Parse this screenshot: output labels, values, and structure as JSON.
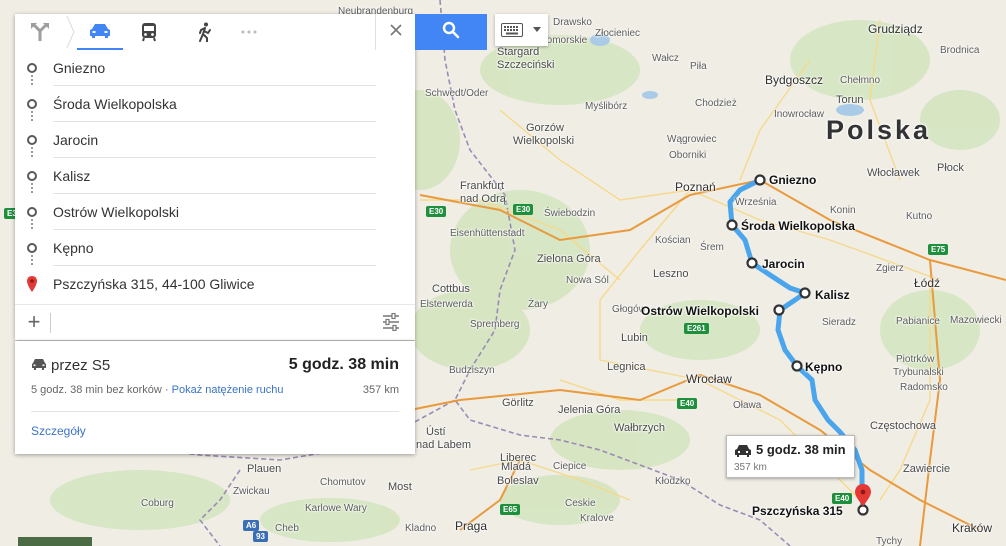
{
  "map": {
    "country_label": "Polska",
    "places": [
      {
        "name": "Neubrandenburg",
        "cls": "small"
      },
      {
        "name": "Drawsko",
        "cls": "small"
      },
      {
        "name": "Pomorskie",
        "cls": "small"
      },
      {
        "name": "Złocieniec",
        "cls": "small"
      },
      {
        "name": "Grudziądz",
        "cls": ""
      },
      {
        "name": "Brodnica",
        "cls": "small"
      },
      {
        "name": "Stargard",
        "cls": ""
      },
      {
        "name": "Szczeciński",
        "cls": ""
      },
      {
        "name": "Wałcz",
        "cls": "small"
      },
      {
        "name": "Piła",
        "cls": "small"
      },
      {
        "name": "Bydgoszcz",
        "cls": "city"
      },
      {
        "name": "Chełmno",
        "cls": "small"
      },
      {
        "name": "Schwedt/Oder",
        "cls": "small"
      },
      {
        "name": "Myślibórz",
        "cls": "small"
      },
      {
        "name": "Chodzież",
        "cls": "small"
      },
      {
        "name": "Inowrocław",
        "cls": "small"
      },
      {
        "name": "Torun",
        "cls": ""
      },
      {
        "name": "Gorzów",
        "cls": ""
      },
      {
        "name": "Wielkopolski",
        "cls": ""
      },
      {
        "name": "Wągrowiec",
        "cls": "small"
      },
      {
        "name": "Oborniki",
        "cls": "small"
      },
      {
        "name": "Włocławek",
        "cls": ""
      },
      {
        "name": "Płock",
        "cls": ""
      },
      {
        "name": "Poznań",
        "cls": "city"
      },
      {
        "name": "Konin",
        "cls": "small"
      },
      {
        "name": "Kutno",
        "cls": "small"
      },
      {
        "name": "Frankfurt",
        "cls": ""
      },
      {
        "name": "nad Odrą",
        "cls": ""
      },
      {
        "name": "Eisenhüttenstadt",
        "cls": "small"
      },
      {
        "name": "Świebodzin",
        "cls": "small"
      },
      {
        "name": "Września",
        "cls": "small"
      },
      {
        "name": "Kościan",
        "cls": "small"
      },
      {
        "name": "Śrem",
        "cls": "small"
      },
      {
        "name": "Zielona Góra",
        "cls": ""
      },
      {
        "name": "Nowa Sól",
        "cls": "small"
      },
      {
        "name": "Leszno",
        "cls": ""
      },
      {
        "name": "Łódź",
        "cls": "city"
      },
      {
        "name": "Zgierz",
        "cls": "small"
      },
      {
        "name": "Cottbus",
        "cls": ""
      },
      {
        "name": "Żary",
        "cls": "small"
      },
      {
        "name": "Spremberg",
        "cls": "small"
      },
      {
        "name": "Głogów",
        "cls": "small"
      },
      {
        "name": "Pabianice",
        "cls": "small"
      },
      {
        "name": "Mazowiecki",
        "cls": "small"
      },
      {
        "name": "Sieradz",
        "cls": "small"
      },
      {
        "name": "Lubin",
        "cls": ""
      },
      {
        "name": "Piotrków",
        "cls": "small"
      },
      {
        "name": "Trybunalski",
        "cls": "small"
      },
      {
        "name": "Budziszyn",
        "cls": "small"
      },
      {
        "name": "Legnica",
        "cls": ""
      },
      {
        "name": "Radomsko",
        "cls": "small"
      },
      {
        "name": "Görlitz",
        "cls": ""
      },
      {
        "name": "Wrocław",
        "cls": "city"
      },
      {
        "name": "Oława",
        "cls": "small"
      },
      {
        "name": "Jelenia Góra",
        "cls": ""
      },
      {
        "name": "Wałbrzych",
        "cls": ""
      },
      {
        "name": "Częstochowa",
        "cls": ""
      },
      {
        "name": "Ústí",
        "cls": ""
      },
      {
        "name": "nad Labem",
        "cls": ""
      },
      {
        "name": "Liberec",
        "cls": ""
      },
      {
        "name": "Zawiercie",
        "cls": ""
      },
      {
        "name": "Plauen",
        "cls": ""
      },
      {
        "name": "Chomutov",
        "cls": "small"
      },
      {
        "name": "Mladá",
        "cls": ""
      },
      {
        "name": "Boleslav",
        "cls": ""
      },
      {
        "name": "Coburg",
        "cls": "small"
      },
      {
        "name": "Most",
        "cls": ""
      },
      {
        "name": "Karlowe Wary",
        "cls": "small"
      },
      {
        "name": "Kladno",
        "cls": "small"
      },
      {
        "name": "Praga",
        "cls": "city"
      },
      {
        "name": "Kraków",
        "cls": "city"
      },
      {
        "name": "Tychy",
        "cls": "small"
      },
      {
        "name": "Cheb",
        "cls": "small"
      },
      {
        "name": "Kralove",
        "cls": "small"
      },
      {
        "name": "Kłodzko",
        "cls": "small"
      },
      {
        "name": "Ciepice",
        "cls": "small"
      },
      {
        "name": "Ceskie",
        "cls": "small"
      },
      {
        "name": "Zwickau",
        "cls": "small"
      },
      {
        "name": "Elsterwerda",
        "cls": "small"
      }
    ],
    "shields": [
      {
        "label": "E30",
        "color": "green"
      },
      {
        "label": "E30",
        "color": "green"
      },
      {
        "label": "E3",
        "color": "green"
      },
      {
        "label": "E75",
        "color": "green"
      },
      {
        "label": "E261",
        "color": "green"
      },
      {
        "label": "E40",
        "color": "green"
      },
      {
        "label": "E40",
        "color": "green"
      },
      {
        "label": "E65",
        "color": "green"
      },
      {
        "label": "A6",
        "color": "blue"
      },
      {
        "label": "93",
        "color": "blue"
      }
    ],
    "route_waypoints": [
      {
        "label": "Gniezno"
      },
      {
        "label": "Środa Wielkopolska"
      },
      {
        "label": "Jarocin"
      },
      {
        "label": "Kalisz"
      },
      {
        "label": "Ostrów Wielkopolski"
      },
      {
        "label": "Kępno"
      },
      {
        "label": "Pszczyńska 315"
      }
    ],
    "route_color": "#4aa5ec",
    "pin_color": "#e53935"
  },
  "panel": {
    "modes": [
      {
        "name": "directions-icon",
        "active": false
      },
      {
        "name": "car-icon",
        "active": true
      },
      {
        "name": "transit-icon",
        "active": false
      },
      {
        "name": "walk-icon",
        "active": false
      },
      {
        "name": "more-icon",
        "active": false
      }
    ],
    "waypoints": [
      "Gniezno",
      "Środa Wielkopolska",
      "Jarocin",
      "Kalisz",
      "Ostrów Wielkopolski",
      "Kępno",
      "Pszczyńska 315, 44-100 Gliwice"
    ],
    "add_label": "+",
    "accent_color": "#4285f4"
  },
  "route": {
    "via": "przez S5",
    "time": "5 godz. 38 min",
    "detail": "5 godz. 38 min bez korków · ",
    "traffic_link": "Pokaż natężenie ruchu",
    "distance": "357 km",
    "details_link": "Szczegóły"
  },
  "bubble": {
    "time": "5 godz. 38 min",
    "distance": "357 km"
  }
}
